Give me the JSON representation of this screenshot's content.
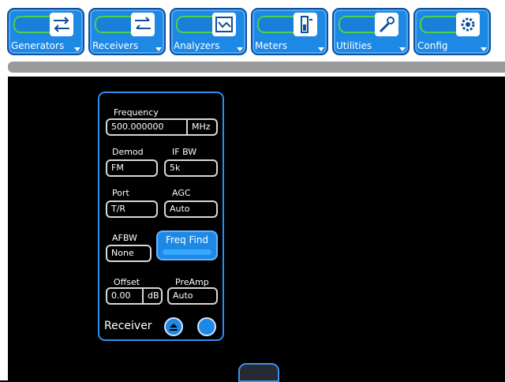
{
  "menu": {
    "items": [
      {
        "label": "Generators",
        "icon": "arrows-swap-icon"
      },
      {
        "label": "Receivers",
        "icon": "arrows-swap-reverse-icon"
      },
      {
        "label": "Analyzers",
        "icon": "waveform-icon"
      },
      {
        "label": "Meters",
        "icon": "meter-icon"
      },
      {
        "label": "Utilities",
        "icon": "wrench-icon"
      },
      {
        "label": "Config",
        "icon": "gear-icon"
      }
    ]
  },
  "receiver": {
    "frequency_label": "Frequency",
    "frequency_value": "500.000000",
    "frequency_unit": "MHz",
    "demod_label": "Demod",
    "demod_value": "FM",
    "ifbw_label": "IF BW",
    "ifbw_value": "5k",
    "port_label": "Port",
    "port_value": "T/R",
    "agc_label": "AGC",
    "agc_value": "Auto",
    "afbw_label": "AFBW",
    "afbw_value": "None",
    "freq_find_label": "Freq Find",
    "offset_label": "Offset",
    "offset_value": "0.00",
    "offset_unit": "dB",
    "preamp_label": "PreAmp",
    "preamp_value": "Auto",
    "title": "Receiver"
  }
}
